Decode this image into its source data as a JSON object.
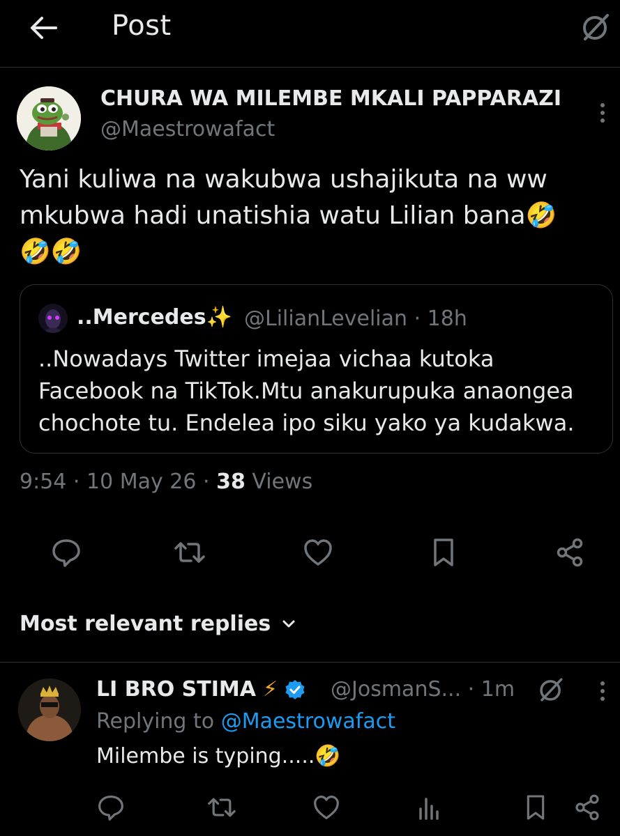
{
  "header": {
    "title": "Post",
    "back_icon": "back-arrow-icon",
    "grok_icon": "grok-icon"
  },
  "post": {
    "author_name": "CHURA WA MILEMBE MKALI PAPPARAZI",
    "author_handle": "@Maestrowafact",
    "text_line1": "Yani kuliwa na wakubwa ushajikuta na ww",
    "text_line2": "mkubwa hadi unatishia watu Lilian bana🤣",
    "text_line3": "🤣🤣",
    "quote": {
      "name": "..Mercedes✨",
      "handle": "@LilianLevelian",
      "time": "· 18h",
      "text_line1": "..Nowadays Twitter imejaa vichaa kutoka",
      "text_line2": "Facebook na TikTok.Mtu anakurupuka anaongea",
      "text_line3": "chochote tu. Endelea ipo siku yako ya kudakwa."
    },
    "time": "9:54",
    "date": "10 May 26",
    "views_count": "38",
    "views_label": "Views",
    "actions": [
      "reply-icon",
      "retweet-icon",
      "like-icon",
      "bookmark-icon",
      "share-icon"
    ]
  },
  "replies_header": {
    "label": "Most relevant replies",
    "icon": "chevron-down-icon"
  },
  "reply": {
    "name": "LI BRO STIMA",
    "name_emoji": "⚡",
    "handle": "@JosmanS...",
    "time": "· 1m",
    "replying_prefix": "Replying to",
    "replying_mention": "@Maestrowafact",
    "text": "Milembe is typing.....🤣",
    "actions": [
      "reply-icon",
      "retweet-icon",
      "like-icon",
      "views-icon",
      "bookmark-icon",
      "share-icon"
    ]
  },
  "colors": {
    "background": "#000000",
    "text": "#e7e9ea",
    "secondary": "#71767b",
    "accent": "#1d9bf0",
    "divider": "#2f3336"
  }
}
